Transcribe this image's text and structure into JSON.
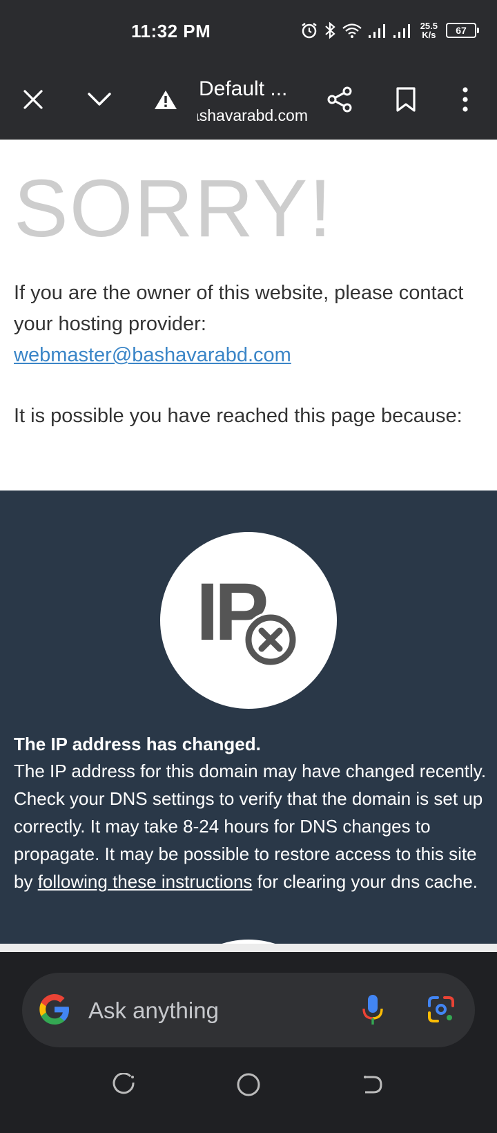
{
  "status_bar": {
    "time": "11:32 PM",
    "net_speed_value": "25.5",
    "net_speed_unit": "K/s",
    "battery": "67",
    "icons": [
      "alarm-icon",
      "bluetooth-icon",
      "wifi-icon",
      "signal-icon",
      "signal-icon",
      "battery-icon"
    ]
  },
  "toolbar": {
    "title": "Default ...",
    "url": "bashavarabd.com",
    "icons": [
      "close-icon",
      "chevron-down-icon",
      "warning-icon",
      "share-icon",
      "bookmark-icon",
      "more-vert-icon"
    ]
  },
  "page": {
    "sorry": "SORRY!",
    "owner_text": "If you are the owner of this website, please contact your hosting provider:",
    "email": "webmaster@bashavarabd.com",
    "reason_intro": "It is possible you have reached this page because:",
    "ip_heading": "The IP address has changed.",
    "ip_body_1": "The IP address for this domain may have changed recently. Check your DNS settings to verify that the domain is set up correctly. It may take 8-24 hours for DNS changes to propagate. It may be possible to restore access to this site by ",
    "ip_link": "following these instructions",
    "ip_body_2": " for clearing your dns cache.",
    "ip_icon_text": "IP",
    "colors": {
      "dark_section": "#2a3848",
      "sorry": "#cdcdcd",
      "link": "#3a85c7"
    }
  },
  "search": {
    "placeholder": "Ask anything",
    "icons": [
      "google-logo-icon",
      "microphone-icon",
      "lens-camera-icon"
    ]
  },
  "nav": {
    "icons": [
      "recent-apps-icon",
      "home-icon",
      "back-icon"
    ]
  }
}
